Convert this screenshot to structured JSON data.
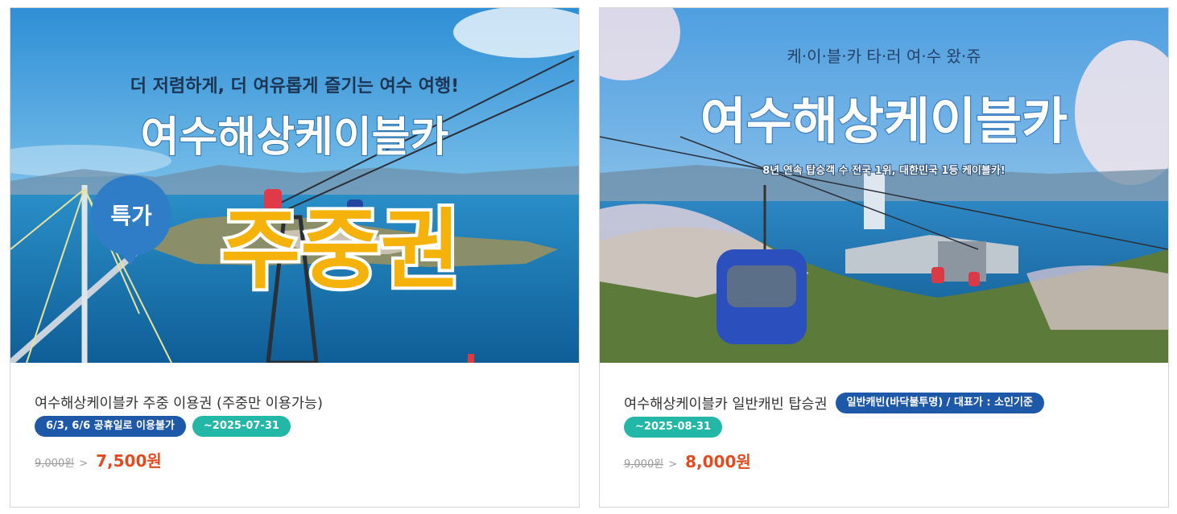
{
  "products": [
    {
      "banner": {
        "headline": "더 저렴하게, 더 여유롭게 즐기는 여수 여행!",
        "title": "여수해상케이블카",
        "badge": "특가",
        "big_text": "주중권"
      },
      "title": "여수해상케이블카 주중 이용권 (주중만 이용가능)",
      "tags": [
        "6/3, 6/6 공휴일로 이용불가",
        "~2025-07-31"
      ],
      "original_price": "9,000원",
      "arrow": ">",
      "sale_price": "7,500원"
    },
    {
      "banner": {
        "headline": "케·이·블·카  타·러  여·수  왔·쥬",
        "title": "여수해상케이블카",
        "subline": "8년 연속 탑승객 수 전국 1위, 대한민국 1등 케이블카!"
      },
      "title": "여수해상케이블카 일반캐빈 탑승권",
      "tags": [
        "일반캐빈(바닥불투명) / 대표가 : 소인기준",
        "~2025-08-31"
      ],
      "original_price": "9,000원",
      "arrow": ">",
      "sale_price": "8,000원"
    }
  ],
  "colors": {
    "tag_blue": "#1e58a8",
    "tag_teal": "#22b7a7",
    "sale_price": "#e14b1f",
    "original_price": "#9a9a9a"
  }
}
